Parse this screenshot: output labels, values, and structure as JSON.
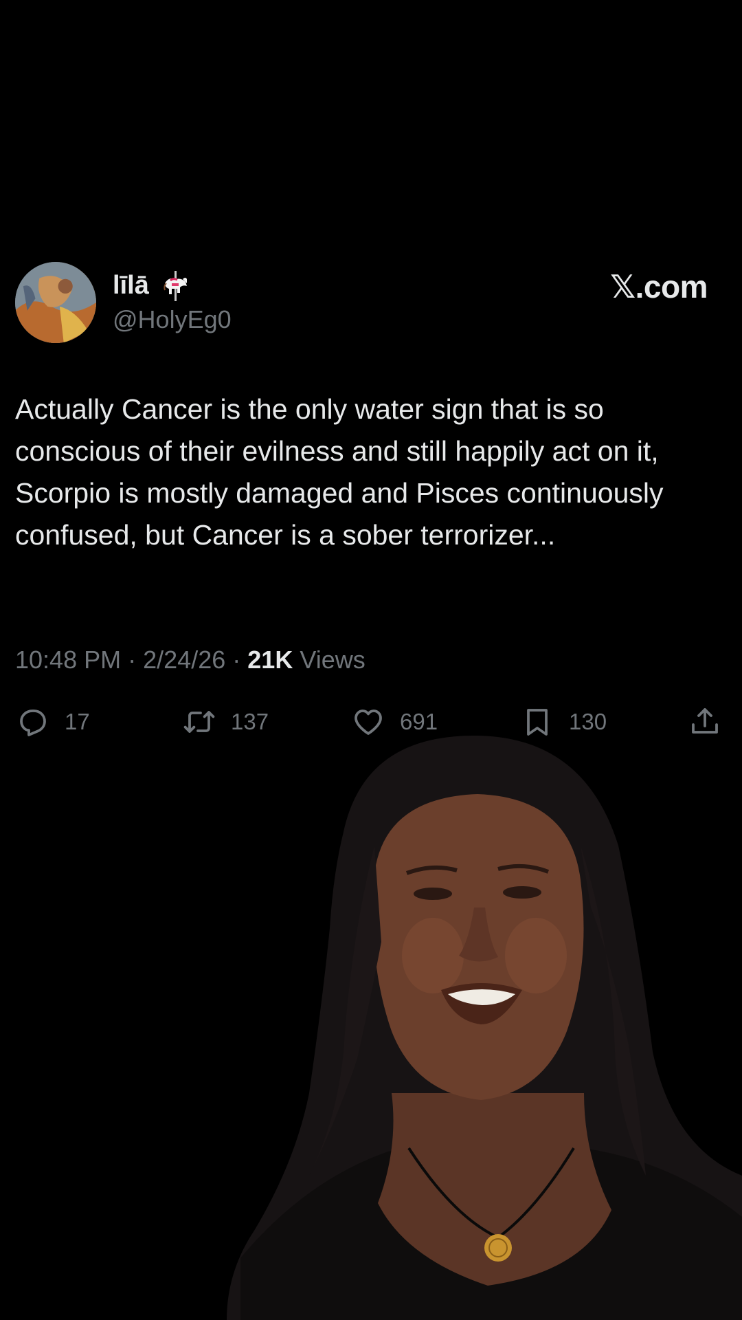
{
  "tweet": {
    "display_name": "līlā",
    "name_emoji": "carousel-horse-icon",
    "handle": "@HolyEg0",
    "brand": "𝕏.com",
    "text": "Actually Cancer is the only water sign that is so conscious of their evilness and still happily act on it, Scorpio is mostly damaged and Pisces continuously confused, but Cancer is a sober terrorizer...",
    "time": "10:48 PM",
    "date": "2/24/26",
    "separator": "·",
    "views_count": "21K",
    "views_label": "Views"
  },
  "actions": {
    "reply": {
      "icon": "reply-icon",
      "count": "17"
    },
    "retweet": {
      "icon": "retweet-icon",
      "count": "137"
    },
    "like": {
      "icon": "heart-icon",
      "count": "691"
    },
    "bookmark": {
      "icon": "bookmark-icon",
      "count": "130"
    },
    "share": {
      "icon": "share-icon"
    }
  },
  "colors": {
    "background": "#000000",
    "primary_text": "#e7e9ea",
    "secondary_text": "#71767b"
  }
}
